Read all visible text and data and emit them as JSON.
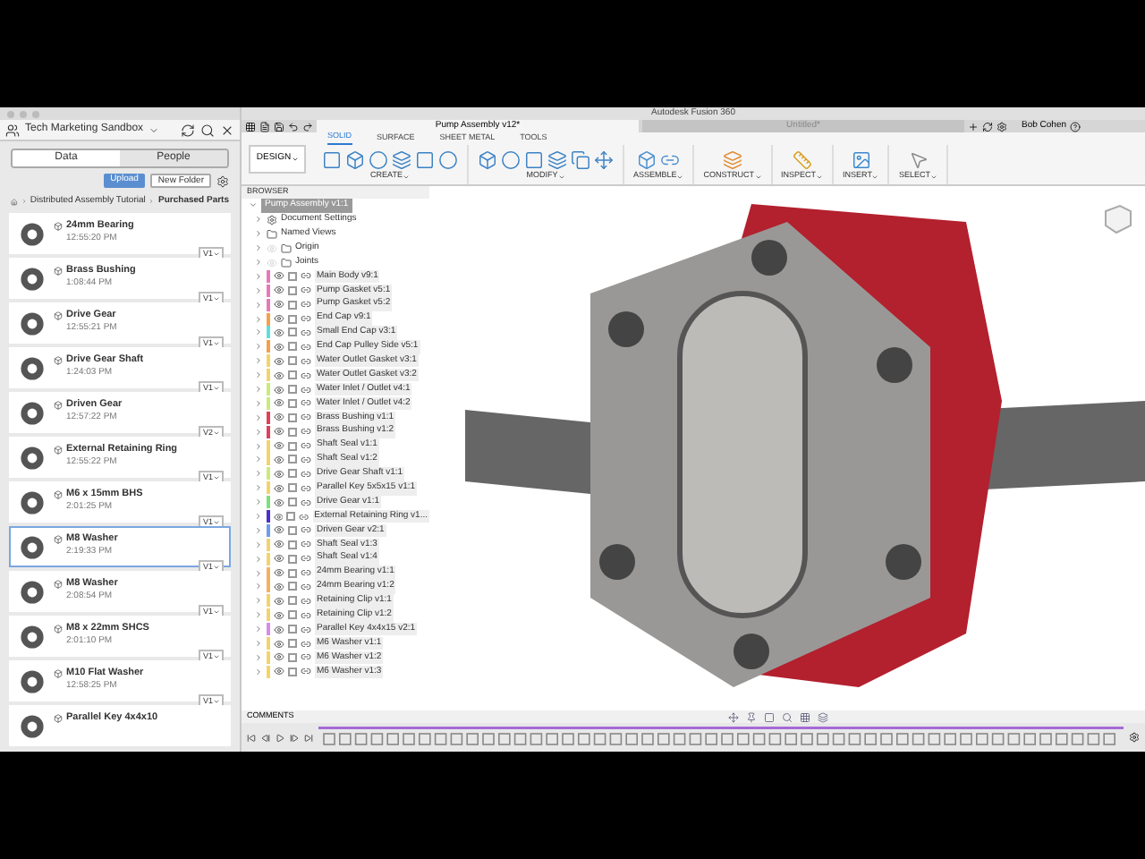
{
  "app_title": "Autodesk Fusion 360",
  "data_panel": {
    "project": "Tech Marketing Sandbox",
    "tabs": [
      {
        "label": "Data",
        "selected": true
      },
      {
        "label": "People",
        "selected": false
      }
    ],
    "upload": "Upload",
    "new_folder": "New Folder",
    "breadcrumb": [
      "Distributed Assembly Tutorial",
      "Purchased Parts"
    ],
    "items": [
      {
        "name": "24mm Bearing",
        "time": "12:55:20 PM",
        "version": "V1",
        "selected": false
      },
      {
        "name": "Brass Bushing",
        "time": "1:08:44 PM",
        "version": "V1",
        "selected": false
      },
      {
        "name": "Drive Gear",
        "time": "12:55:21 PM",
        "version": "V1",
        "selected": false
      },
      {
        "name": "Drive Gear Shaft",
        "time": "1:24:03 PM",
        "version": "V1",
        "selected": false
      },
      {
        "name": "Driven Gear",
        "time": "12:57:22 PM",
        "version": "V2",
        "selected": false
      },
      {
        "name": "External Retaining Ring",
        "time": "12:55:22 PM",
        "version": "V1",
        "selected": false
      },
      {
        "name": "M6 x 15mm BHS",
        "time": "2:01:25 PM",
        "version": "V1",
        "selected": false
      },
      {
        "name": "M8 Washer",
        "time": "2:19:33 PM",
        "version": "V1",
        "selected": true
      },
      {
        "name": "M8 Washer",
        "time": "2:08:54 PM",
        "version": "V1",
        "selected": false
      },
      {
        "name": "M8 x 22mm SHCS",
        "time": "2:01:10 PM",
        "version": "V1",
        "selected": false
      },
      {
        "name": "M10 Flat Washer",
        "time": "12:58:25 PM",
        "version": "V1",
        "selected": false
      },
      {
        "name": "Parallel Key 4x4x10",
        "selected": false
      }
    ]
  },
  "document_tabs": [
    {
      "label": "Pump Assembly v12*",
      "selected": true
    },
    {
      "label": "Untitled*",
      "selected": false
    }
  ],
  "user": "Bob Cohen",
  "workspace": "DESIGN",
  "tool_tabs": [
    {
      "label": "SOLID",
      "selected": true
    },
    {
      "label": "SURFACE",
      "selected": false
    },
    {
      "label": "SHEET METAL",
      "selected": false
    },
    {
      "label": "TOOLS",
      "selected": false
    }
  ],
  "tool_groups": [
    "CREATE",
    "MODIFY",
    "ASSEMBLE",
    "CONSTRUCT",
    "INSPECT",
    "INSERT",
    "SELECT"
  ],
  "browser": {
    "title": "BROWSER",
    "root": "Pump Assembly v1:1",
    "nodes": [
      {
        "kind": "settings",
        "name": "Document Settings"
      },
      {
        "kind": "folder",
        "name": "Named Views"
      },
      {
        "kind": "folder",
        "name": "Origin",
        "visible": false
      },
      {
        "kind": "folder",
        "name": "Joints",
        "visible": false
      }
    ],
    "components": [
      {
        "name": "Main Body v9:1",
        "color": "#e879b9",
        "checked": false
      },
      {
        "name": "Pump Gasket v5:1",
        "color": "#e879b9",
        "checked": false
      },
      {
        "name": "Pump Gasket v5:2",
        "color": "#e879b9",
        "checked": false
      },
      {
        "name": "End Cap v9:1",
        "color": "#f5a04a",
        "checked": false
      },
      {
        "name": "Small End Cap v3:1",
        "color": "#5ee0d8",
        "checked": false
      },
      {
        "name": "End Cap Pulley Side v5:1",
        "color": "#f5a04a",
        "checked": false
      },
      {
        "name": "Water Outlet Gasket v3:1",
        "color": "#f3d36b",
        "checked": false
      },
      {
        "name": "Water Outlet Gasket v3:2",
        "color": "#f3d36b",
        "checked": false
      },
      {
        "name": "Water Inlet / Outlet v4:1",
        "color": "#c8ec7a",
        "checked": false
      },
      {
        "name": "Water Inlet / Outlet v4:2",
        "color": "#c8ec7a",
        "checked": false
      },
      {
        "name": "Brass Bushing v1:1",
        "color": "#e0405a",
        "checked": false
      },
      {
        "name": "Brass Bushing v1:2",
        "color": "#e0405a",
        "checked": false
      },
      {
        "name": "Shaft Seal v1:1",
        "color": "#f3d36b",
        "checked": false
      },
      {
        "name": "Shaft Seal v1:2",
        "color": "#f3d36b",
        "checked": false
      },
      {
        "name": "Drive Gear Shaft v1:1",
        "color": "#c8ec7a",
        "checked": false
      },
      {
        "name": "Parallel Key 5x5x15 v1:1",
        "color": "#f3d36b",
        "checked": false
      },
      {
        "name": "Drive Gear v1:1",
        "color": "#7ee07a",
        "checked": false
      },
      {
        "name": "External Retaining Ring v1...",
        "color": "#4b2fd0",
        "checked": false
      },
      {
        "name": "Driven Gear v2:1",
        "color": "#6f9ee8",
        "checked": false
      },
      {
        "name": "Shaft Seal v1:3",
        "color": "#f3d36b",
        "checked": false
      },
      {
        "name": "Shaft Seal v1:4",
        "color": "#f3d36b",
        "checked": false
      },
      {
        "name": "24mm Bearing v1:1",
        "color": "#f5b060",
        "checked": false
      },
      {
        "name": "24mm Bearing v1:2",
        "color": "#f5b060",
        "checked": false
      },
      {
        "name": "Retaining Clip v1:1",
        "color": "#f3d36b",
        "checked": false
      },
      {
        "name": "Retaining Clip v1:2",
        "color": "#f3d36b",
        "checked": false
      },
      {
        "name": "Parallel Key 4x4x15 v2:1",
        "color": "#d98ae8",
        "checked": false
      },
      {
        "name": "M6 Washer v1:1",
        "color": "#f3d36b",
        "checked": false
      },
      {
        "name": "M6 Washer v1:2",
        "color": "#f3d36b",
        "checked": false
      },
      {
        "name": "M6 Washer v1:3",
        "color": "#f3d36b",
        "checked": false
      }
    ]
  },
  "comments": "COMMENTS"
}
